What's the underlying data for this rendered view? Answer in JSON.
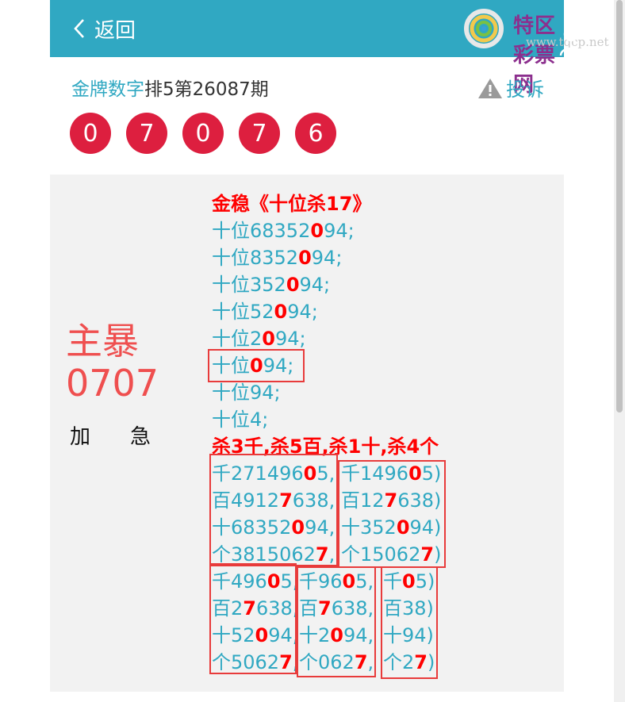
{
  "header": {
    "back_label": "返回",
    "logo_text": "特区彩票网",
    "logo_url": "www.tqcp.net"
  },
  "title": {
    "highlight": "金牌数字",
    "rest": "排5第26087期"
  },
  "report_label": "投诉",
  "balls": [
    "0",
    "7",
    "0",
    "7",
    "6"
  ],
  "left_labels": {
    "main": "主暴",
    "number": "0707",
    "urgent": "加急"
  },
  "section1": {
    "heading": "金稳《十位杀17》",
    "lines": [
      [
        "十位683520",
        "94;"
      ],
      [
        "十位83520",
        "94;"
      ],
      [
        "十位3520",
        "94;"
      ],
      [
        "十位520",
        "94;"
      ],
      [
        "十位20",
        "94;"
      ],
      [
        "十位0",
        "94;"
      ],
      [
        "十位94;",
        ""
      ],
      [
        "十位4;",
        ""
      ]
    ]
  },
  "section2": {
    "heading": "杀3千,杀5百,杀1十,杀4个",
    "block_a": [
      [
        "千2714960",
        "5,"
      ],
      [
        "百49127",
        "638,"
      ],
      [
        "十683520",
        "94,"
      ],
      [
        "个38150627",
        ","
      ]
    ],
    "block_b": [
      [
        "千14960",
        "5)"
      ],
      [
        "百127",
        "638)"
      ],
      [
        "十3520",
        "94)"
      ],
      [
        "个150627",
        ")"
      ]
    ],
    "block_c": [
      [
        "千4960",
        "5,"
      ],
      [
        "百27",
        "638,"
      ],
      [
        "十520",
        "94,"
      ],
      [
        "个50627",
        ","
      ]
    ],
    "block_d": [
      [
        "千960",
        "5,"
      ],
      [
        "百7",
        "638,"
      ],
      [
        "十20",
        "94,"
      ],
      [
        "个0627",
        ","
      ]
    ],
    "block_e": [
      [
        "千0",
        "5)"
      ],
      [
        "百38)",
        ""
      ],
      [
        "十94)",
        ""
      ],
      [
        "个27",
        ")"
      ]
    ]
  },
  "colors": {
    "accent": "#30a8c2",
    "ball": "#dd1f3f",
    "highlight": "#ff0000",
    "box": "#e83b3b"
  }
}
